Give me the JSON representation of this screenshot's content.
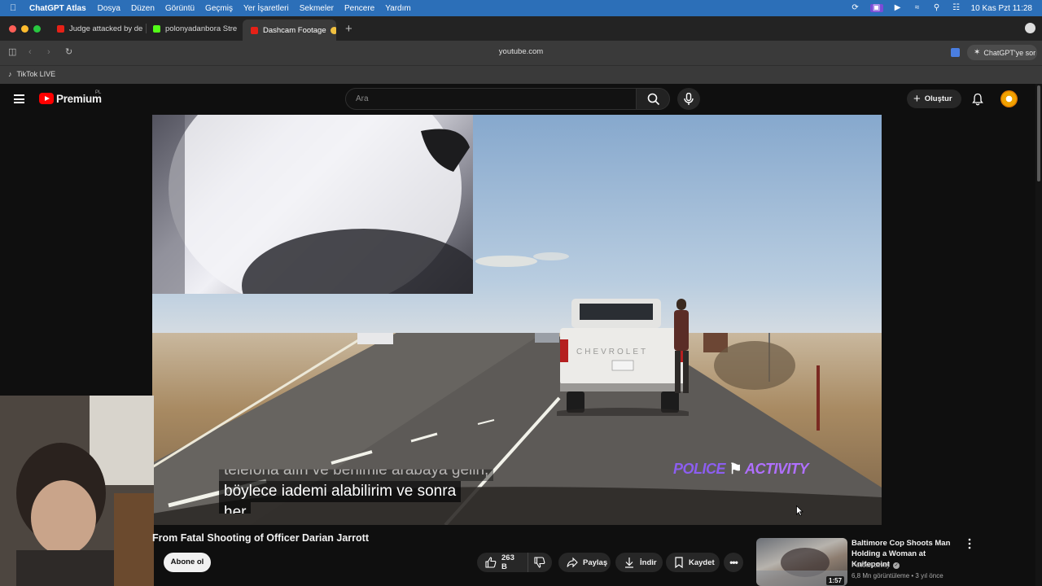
{
  "menubar": {
    "app_name": "ChatGPT Atlas",
    "items": [
      "Dosya",
      "Düzen",
      "Görüntü",
      "Geçmiş",
      "Yer İşaretleri",
      "Sekmeler",
      "Pencere",
      "Yardım"
    ],
    "clock": "10 Kas Pzt  11:28"
  },
  "tabs": [
    {
      "label": "Judge attacked by de",
      "favicon_color": "#e62117"
    },
    {
      "label": "polonyadanbora Stre",
      "favicon_color": "#53fc18"
    },
    {
      "label": "Dashcam Footage",
      "favicon_color": "#e62117"
    }
  ],
  "toolbar": {
    "url": "youtube.com",
    "ask_label": "ChatGPT'ye sor"
  },
  "bookmarks": [
    {
      "label": "TikTok LIVE"
    }
  ],
  "youtube": {
    "brand": "Premium",
    "country": "PL",
    "search_placeholder": "Ara",
    "create_label": "Oluştur"
  },
  "player": {
    "subtitle_line1": "telefona alın ve benimle arabaya gelin,",
    "subtitle_line2": "böylece iademi alabilirim ve sonra",
    "subtitle_line3": "her",
    "watermark_a": "POLICE",
    "watermark_b": "ACTIVITY",
    "truck_text": "CHEVROLET"
  },
  "video": {
    "title": "From Fatal Shooting of Officer Darian Jarrott",
    "subscribe_label": "Abone ol",
    "like_count": "263 B",
    "share_label": "Paylaş",
    "download_label": "İndir",
    "save_label": "Kaydet"
  },
  "recommendation": {
    "title": "Baltimore Cop Shoots Man Holding a Woman at Knifepoint",
    "channel": "PoliceActivity",
    "meta": "6,8 Mn görüntüleme • 3 yıl önce",
    "duration": "1:57"
  }
}
